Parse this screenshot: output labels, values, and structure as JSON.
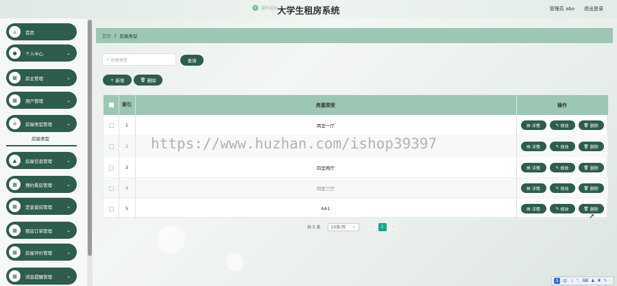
{
  "header": {
    "app_title": "大学生租房系统",
    "toast_text": "操作成功",
    "user_label": "管理员 abo",
    "logout_label": "退出登录"
  },
  "sidebar": {
    "items": [
      {
        "label": "首页",
        "icon": "home-icon",
        "has_chevron": false
      },
      {
        "label": "个人中心",
        "icon": "user-icon",
        "has_chevron": true
      },
      {
        "label": "房主管理",
        "icon": "grid-icon",
        "has_chevron": true
      },
      {
        "label": "用户管理",
        "icon": "grid-icon",
        "has_chevron": true
      },
      {
        "label": "房屋类型管理",
        "icon": "list-icon",
        "has_chevron": true
      },
      {
        "label": "房屋信息管理",
        "icon": "house-icon",
        "has_chevron": true
      },
      {
        "label": "预约看房管理",
        "icon": "grid-icon",
        "has_chevron": true
      },
      {
        "label": "定金留房管理",
        "icon": "grid-icon",
        "has_chevron": true
      },
      {
        "label": "租房订单管理",
        "icon": "grid-icon",
        "has_chevron": true
      },
      {
        "label": "房屋评价管理",
        "icon": "grid-icon",
        "has_chevron": true
      },
      {
        "label": "消息提醒管理",
        "icon": "grid-icon",
        "has_chevron": true
      }
    ],
    "active_sub_item": "房屋类型"
  },
  "breadcrumb": {
    "home": "首页",
    "separator": "/",
    "current": "房屋类型"
  },
  "search": {
    "placeholder": "房屋类型",
    "query_label": "查询"
  },
  "toolbar": {
    "add_label": "新增",
    "delete_label": "删除"
  },
  "table": {
    "headers": {
      "index": "索引",
      "type": "房屋类型",
      "ops": "操作"
    },
    "row_actions": {
      "detail": "详情",
      "edit": "修改",
      "delete": "删除"
    },
    "rows": [
      {
        "index": "1",
        "type": "两室一厅"
      },
      {
        "index": "2",
        "type": ""
      },
      {
        "index": "3",
        "type": "四室两厅"
      },
      {
        "index": "4",
        "type": "四室三厅"
      },
      {
        "index": "5",
        "type": "AA1"
      }
    ]
  },
  "pagination": {
    "total_text": "共 5 条",
    "page_size": "10条/页",
    "current_page": "1"
  },
  "watermark": "https://www.huzhan.com/ishop39397",
  "colors": {
    "primary": "#2e5d4b",
    "header_bg": "#9bc7b3",
    "page_active": "#1aa58b"
  }
}
